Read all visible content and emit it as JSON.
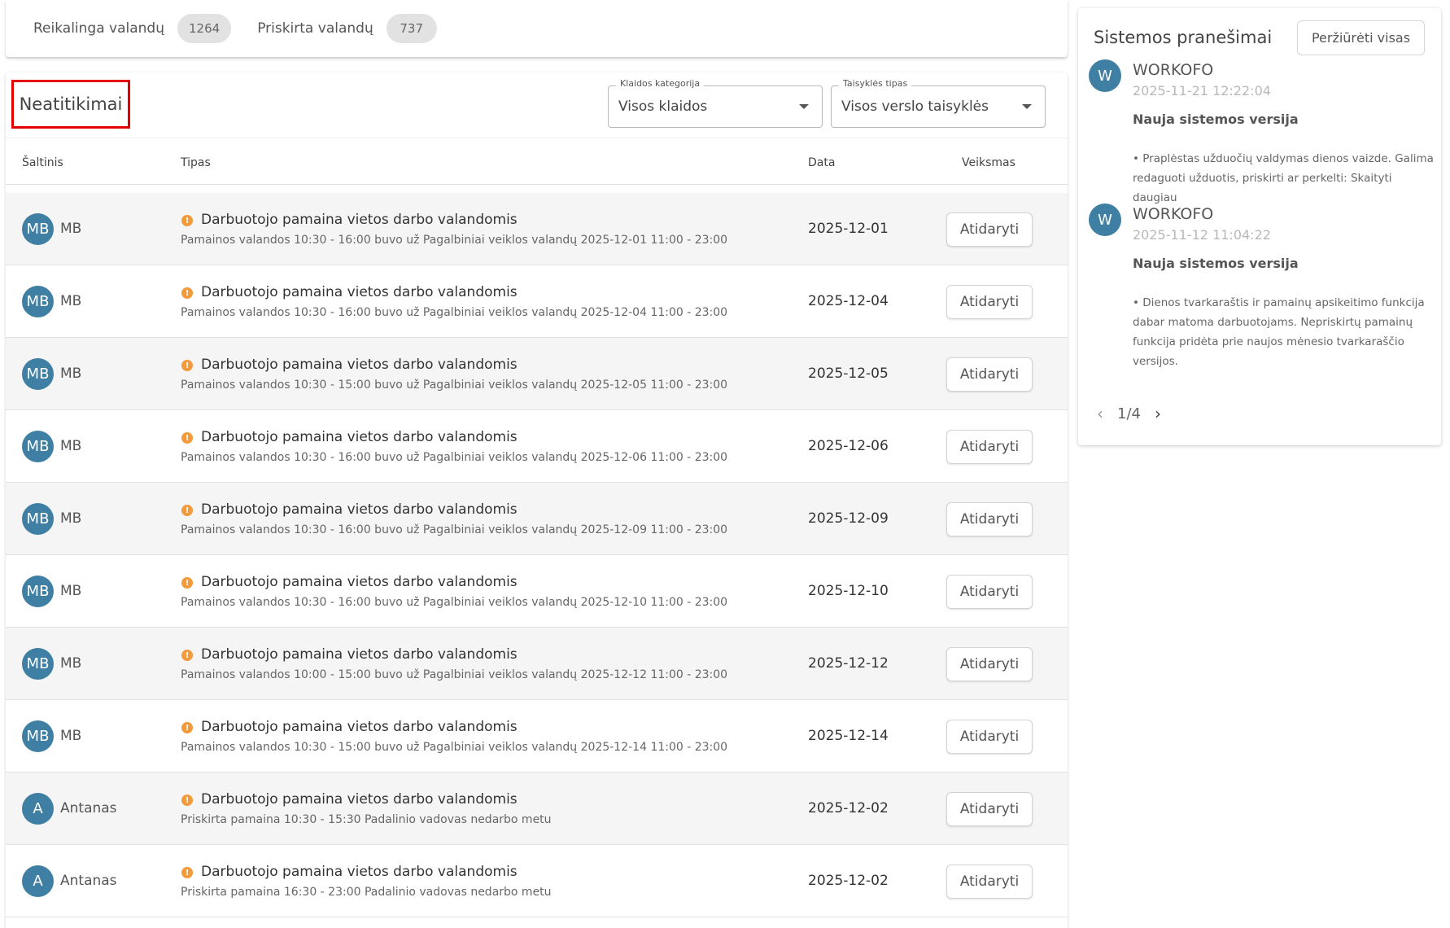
{
  "stats": {
    "required_label": "Reikalinga valandų",
    "required_value": "1264",
    "assigned_label": "Priskirta valandų",
    "assigned_value": "737"
  },
  "main": {
    "title": "Neatitikimai",
    "filters": {
      "category_label": "Klaidos kategorija",
      "category_value": "Visos klaidos",
      "rule_label": "Taisyklės tipas",
      "rule_value": "Visos verslo taisyklės"
    },
    "columns": {
      "source": "Šaltinis",
      "type": "Tipas",
      "date": "Data",
      "action": "Veiksmas"
    },
    "rows": [
      {
        "avatar": "MB",
        "source": "MB",
        "title": "Darbuotojo pamaina vietos darbo valandomis",
        "desc": "Pamainos valandos 10:30 - 16:00 buvo už Pagalbiniai veiklos valandų 2025-12-01 11:00 - 23:00",
        "date": "2025-12-01",
        "action": "Atidaryti"
      },
      {
        "avatar": "MB",
        "source": "MB",
        "title": "Darbuotojo pamaina vietos darbo valandomis",
        "desc": "Pamainos valandos 10:30 - 16:00 buvo už Pagalbiniai veiklos valandų 2025-12-04 11:00 - 23:00",
        "date": "2025-12-04",
        "action": "Atidaryti"
      },
      {
        "avatar": "MB",
        "source": "MB",
        "title": "Darbuotojo pamaina vietos darbo valandomis",
        "desc": "Pamainos valandos 10:30 - 15:00 buvo už Pagalbiniai veiklos valandų 2025-12-05 11:00 - 23:00",
        "date": "2025-12-05",
        "action": "Atidaryti"
      },
      {
        "avatar": "MB",
        "source": "MB",
        "title": "Darbuotojo pamaina vietos darbo valandomis",
        "desc": "Pamainos valandos 10:30 - 16:00 buvo už Pagalbiniai veiklos valandų 2025-12-06 11:00 - 23:00",
        "date": "2025-12-06",
        "action": "Atidaryti"
      },
      {
        "avatar": "MB",
        "source": "MB",
        "title": "Darbuotojo pamaina vietos darbo valandomis",
        "desc": "Pamainos valandos 10:30 - 16:00 buvo už Pagalbiniai veiklos valandų 2025-12-09 11:00 - 23:00",
        "date": "2025-12-09",
        "action": "Atidaryti"
      },
      {
        "avatar": "MB",
        "source": "MB",
        "title": "Darbuotojo pamaina vietos darbo valandomis",
        "desc": "Pamainos valandos 10:30 - 16:00 buvo už Pagalbiniai veiklos valandų 2025-12-10 11:00 - 23:00",
        "date": "2025-12-10",
        "action": "Atidaryti"
      },
      {
        "avatar": "MB",
        "source": "MB",
        "title": "Darbuotojo pamaina vietos darbo valandomis",
        "desc": "Pamainos valandos 10:00 - 15:00 buvo už Pagalbiniai veiklos valandų 2025-12-12 11:00 - 23:00",
        "date": "2025-12-12",
        "action": "Atidaryti"
      },
      {
        "avatar": "MB",
        "source": "MB",
        "title": "Darbuotojo pamaina vietos darbo valandomis",
        "desc": "Pamainos valandos 10:30 - 15:00 buvo už Pagalbiniai veiklos valandų 2025-12-14 11:00 - 23:00",
        "date": "2025-12-14",
        "action": "Atidaryti"
      },
      {
        "avatar": "A",
        "source": "Antanas",
        "title": "Darbuotojo pamaina vietos darbo valandomis",
        "desc": "Priskirta pamaina 10:30 - 15:30 Padalinio vadovas nedarbo metu",
        "date": "2025-12-02",
        "action": "Atidaryti"
      },
      {
        "avatar": "A",
        "source": "Antanas",
        "title": "Darbuotojo pamaina vietos darbo valandomis",
        "desc": "Priskirta pamaina 16:30 - 23:00 Padalinio vadovas nedarbo metu",
        "date": "2025-12-02",
        "action": "Atidaryti"
      }
    ]
  },
  "notifications": {
    "title": "Sistemos pranešimai",
    "view_all": "Peržiūrėti visas",
    "items": [
      {
        "avatar": "W",
        "sender": "WORKOFO",
        "time": "2025-11-21 12:22:04",
        "subject": "Nauja sistemos versija",
        "body": "• Praplėstas užduočių valdymas dienos vaizde. Galima redaguoti užduotis, priskirti ar perkelti: Skaityti daugiau"
      },
      {
        "avatar": "W",
        "sender": "WORKOFO",
        "time": "2025-11-12 11:04:22",
        "subject": "Nauja sistemos versija",
        "body": "• Dienos tvarkaraštis ir pamainų apsikeitimo funkcija dabar matoma darbuotojams. Nepriskirtų pamainų funkcija pridėta prie naujos mėnesio tvarkaraščio versijos."
      }
    ],
    "pager": "1/4"
  },
  "colors": {
    "avatar": "#3f7fa3",
    "warning": "#f39a3c",
    "highlight_border": "#e50000"
  },
  "icons": {
    "warning": "warning-icon",
    "prev": "chevron-left-icon",
    "next": "chevron-right-icon",
    "dropdown": "caret-down-icon"
  }
}
